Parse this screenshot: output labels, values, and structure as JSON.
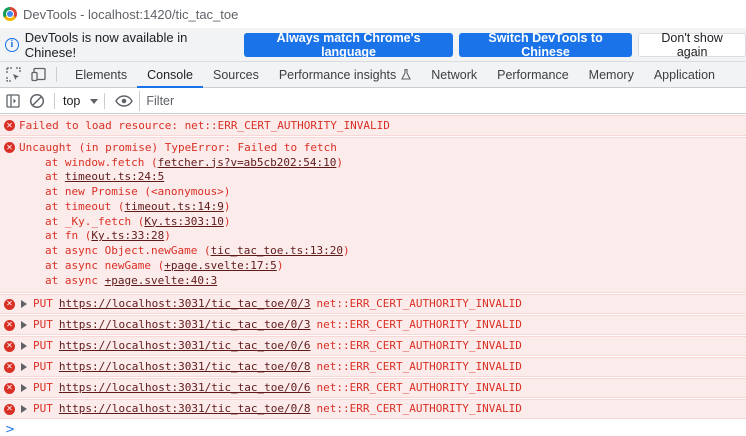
{
  "window": {
    "title": "DevTools - localhost:1420/tic_tac_toe"
  },
  "infobar": {
    "message": "DevTools is now available in Chinese!",
    "btn_match": "Always match Chrome's language",
    "btn_switch": "Switch DevTools to Chinese",
    "btn_dismiss": "Don't show again"
  },
  "tabs": [
    "Elements",
    "Console",
    "Sources",
    "Performance insights",
    "Network",
    "Performance",
    "Memory",
    "Application"
  ],
  "active_tab": "Console",
  "console_toolbar": {
    "context": "top",
    "filter_placeholder": "Filter"
  },
  "messages": {
    "resource_error": "Failed to load resource: net::ERR_CERT_AUTHORITY_INVALID",
    "uncaught": "Uncaught (in promise) TypeError: Failed to fetch",
    "stack": [
      {
        "prefix": "at window.fetch (",
        "link": "fetcher.js?v=ab5cb202:54:10",
        "suffix": ")"
      },
      {
        "prefix": "at ",
        "link": "timeout.ts:24:5",
        "suffix": ""
      },
      {
        "prefix": "at new Promise (<anonymous>)",
        "link": "",
        "suffix": ""
      },
      {
        "prefix": "at timeout (",
        "link": "timeout.ts:14:9",
        "suffix": ")"
      },
      {
        "prefix": "at _Ky._fetch (",
        "link": "Ky.ts:303:10",
        "suffix": ")"
      },
      {
        "prefix": "at fn (",
        "link": "Ky.ts:33:28",
        "suffix": ")"
      },
      {
        "prefix": "at async Object.newGame (",
        "link": "tic_tac_toe.ts:13:20",
        "suffix": ")"
      },
      {
        "prefix": "at async newGame (",
        "link": "+page.svelte:17:5",
        "suffix": ")"
      },
      {
        "prefix": "at async ",
        "link": "+page.svelte:40:3",
        "suffix": ""
      }
    ],
    "network": [
      {
        "method": "PUT",
        "url": "https://localhost:3031/tic_tac_toe/0/3",
        "error": "net::ERR_CERT_AUTHORITY_INVALID"
      },
      {
        "method": "PUT",
        "url": "https://localhost:3031/tic_tac_toe/0/3",
        "error": "net::ERR_CERT_AUTHORITY_INVALID"
      },
      {
        "method": "PUT",
        "url": "https://localhost:3031/tic_tac_toe/0/6",
        "error": "net::ERR_CERT_AUTHORITY_INVALID"
      },
      {
        "method": "PUT",
        "url": "https://localhost:3031/tic_tac_toe/0/8",
        "error": "net::ERR_CERT_AUTHORITY_INVALID"
      },
      {
        "method": "PUT",
        "url": "https://localhost:3031/tic_tac_toe/0/6",
        "error": "net::ERR_CERT_AUTHORITY_INVALID"
      },
      {
        "method": "PUT",
        "url": "https://localhost:3031/tic_tac_toe/0/8",
        "error": "net::ERR_CERT_AUTHORITY_INVALID"
      }
    ],
    "prompt": ">"
  },
  "colors": {
    "accent": "#1a73e8",
    "error_text": "#d93025",
    "error_bg": "#fcebeb"
  },
  "icons": [
    "chrome-logo-icon",
    "info-icon",
    "inspect-element-icon",
    "device-toolbar-icon",
    "flask-icon",
    "sidebar-toggle-icon",
    "clear-console-icon",
    "eye-icon",
    "error-icon",
    "expand-arrow-icon"
  ]
}
